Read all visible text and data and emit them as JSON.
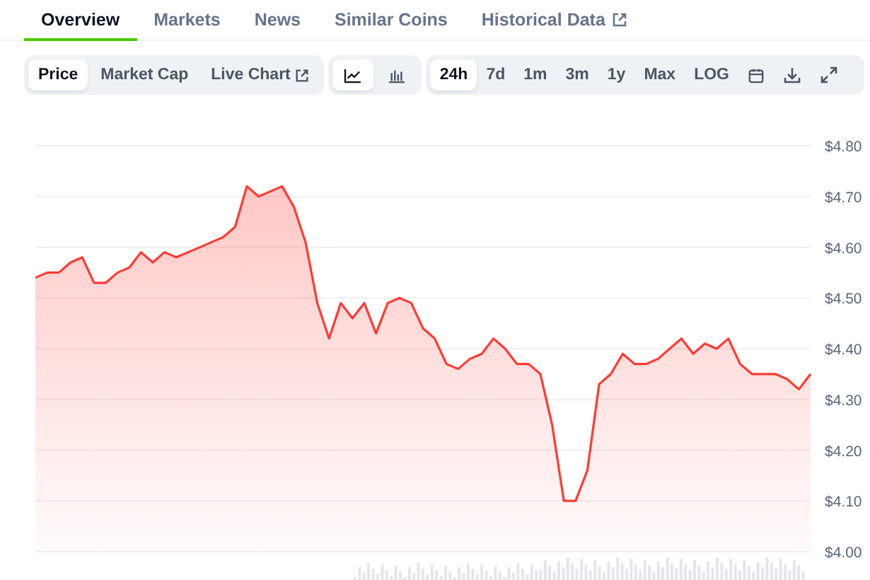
{
  "tabs": [
    {
      "label": "Overview",
      "selected": true,
      "external": false
    },
    {
      "label": "Markets",
      "selected": false,
      "external": false
    },
    {
      "label": "News",
      "selected": false,
      "external": false
    },
    {
      "label": "Similar Coins",
      "selected": false,
      "external": false
    },
    {
      "label": "Historical Data",
      "selected": false,
      "external": true
    }
  ],
  "data_buttons": [
    {
      "label": "Price",
      "selected": true,
      "external": false
    },
    {
      "label": "Market Cap",
      "selected": false,
      "external": false
    },
    {
      "label": "Live Chart",
      "selected": false,
      "external": true
    }
  ],
  "style_buttons": [
    {
      "kind": "line",
      "selected": true
    },
    {
      "kind": "bars",
      "selected": false
    }
  ],
  "range_buttons": [
    {
      "label": "24h",
      "selected": true
    },
    {
      "label": "7d",
      "selected": false
    },
    {
      "label": "1m",
      "selected": false
    },
    {
      "label": "3m",
      "selected": false
    },
    {
      "label": "1y",
      "selected": false
    },
    {
      "label": "Max",
      "selected": false
    },
    {
      "label": "LOG",
      "selected": false
    }
  ],
  "tool_buttons": [
    {
      "kind": "calendar"
    },
    {
      "kind": "download"
    },
    {
      "kind": "expand"
    }
  ],
  "chart_data": {
    "type": "area",
    "grid": true,
    "ylim": [
      4.0,
      4.8
    ],
    "yticks": [
      {
        "value": 4.0,
        "label": "$4.00"
      },
      {
        "value": 4.1,
        "label": "$4.10"
      },
      {
        "value": 4.2,
        "label": "$4.20"
      },
      {
        "value": 4.3,
        "label": "$4.30"
      },
      {
        "value": 4.4,
        "label": "$4.40"
      },
      {
        "value": 4.5,
        "label": "$4.50"
      },
      {
        "value": 4.6,
        "label": "$4.60"
      },
      {
        "value": 4.7,
        "label": "$4.70"
      },
      {
        "value": 4.8,
        "label": "$4.80"
      }
    ],
    "series": [
      {
        "color": "#ff3a33",
        "values": [
          4.54,
          4.55,
          4.55,
          4.57,
          4.58,
          4.53,
          4.53,
          4.55,
          4.56,
          4.59,
          4.57,
          4.59,
          4.58,
          4.59,
          4.6,
          4.61,
          4.62,
          4.64,
          4.72,
          4.7,
          4.71,
          4.72,
          4.68,
          4.61,
          4.49,
          4.42,
          4.49,
          4.46,
          4.49,
          4.43,
          4.49,
          4.5,
          4.49,
          4.44,
          4.42,
          4.37,
          4.36,
          4.38,
          4.39,
          4.42,
          4.4,
          4.37,
          4.37,
          4.35,
          4.25,
          4.1,
          4.1,
          4.16,
          4.33,
          4.35,
          4.39,
          4.37,
          4.37,
          4.38,
          4.4,
          4.42,
          4.39,
          4.41,
          4.4,
          4.42,
          4.37,
          4.35,
          4.35,
          4.35,
          4.34,
          4.32,
          4.35
        ]
      }
    ]
  }
}
